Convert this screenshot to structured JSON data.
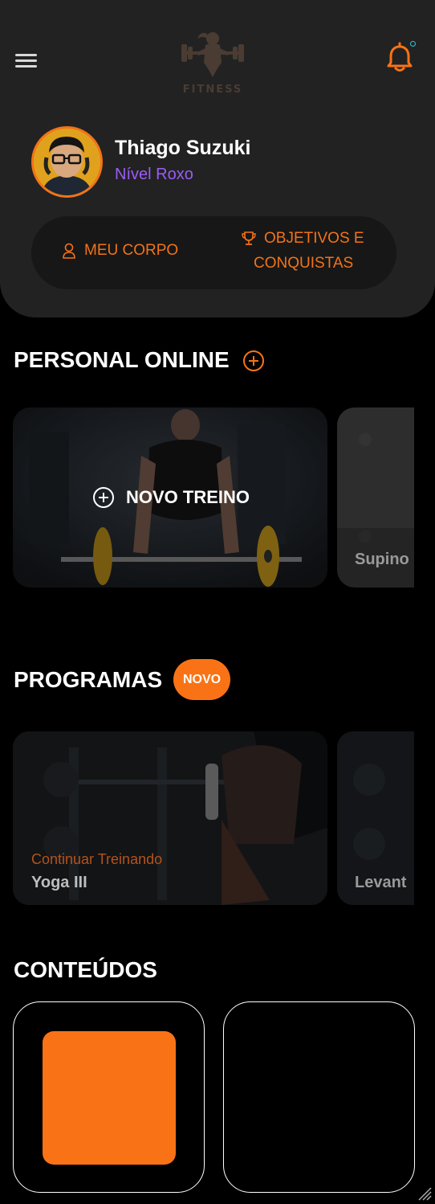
{
  "header": {
    "logo_text": "FITNESS",
    "user": {
      "name": "Thiago Suzuki",
      "level": "Nível Roxo"
    },
    "actions": {
      "meu_corpo": "MEU CORPO",
      "objetivos_line1": "OBJETIVOS E",
      "objetivos_line2": "CONQUISTAS"
    }
  },
  "personal_online": {
    "title": "PERSONAL ONLINE",
    "cards": [
      {
        "label": "NOVO TREINO"
      },
      {
        "label": "Supino"
      }
    ]
  },
  "programas": {
    "title": "PROGRAMAS",
    "badge": "NOVO",
    "cards": [
      {
        "status": "Continuar Treinando",
        "name": "Yoga III"
      },
      {
        "name": "Levant"
      }
    ]
  },
  "conteudos": {
    "title": "CONTEÚDOS"
  },
  "colors": {
    "accent": "#f97316",
    "level": "#9b5cf6",
    "notification_dot": "#2ec4d6"
  },
  "icons": [
    "menu-icon",
    "bell-icon",
    "user-icon",
    "trophy-icon",
    "plus-circle-icon",
    "resize-grip-icon"
  ]
}
